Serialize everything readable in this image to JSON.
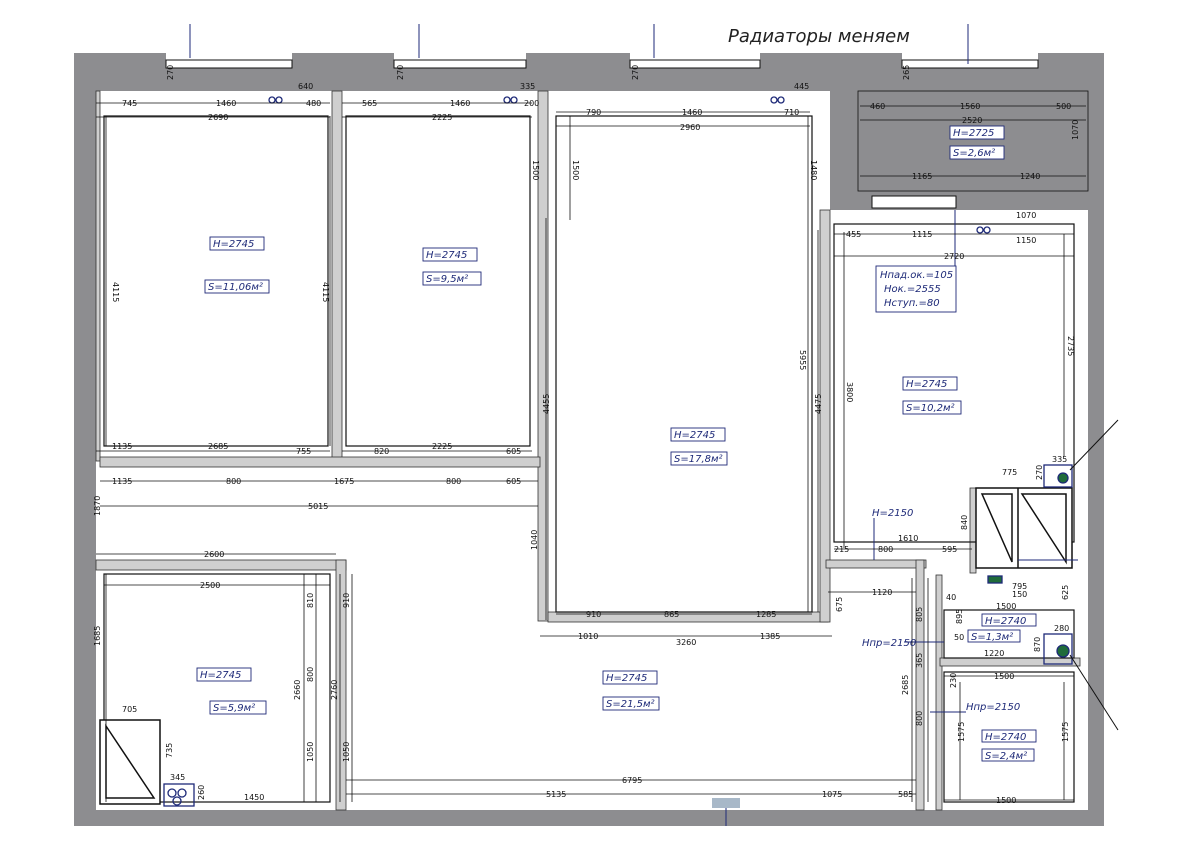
{
  "title": "Радиаторы меняем",
  "colors": {
    "wall": "#8d8d90",
    "partition": "#c8c8c8",
    "line": "#111111",
    "label": "#1e2a78",
    "radiator": "#1e2a78",
    "riser": "#1f6b3a"
  },
  "rooms": [
    {
      "id": "room1",
      "h": "H=2745",
      "s": "S=11,06м²"
    },
    {
      "id": "room2",
      "h": "H=2745",
      "s": "S=9,5м²"
    },
    {
      "id": "room3",
      "h": "H=2745",
      "s": "S=17,8м²"
    },
    {
      "id": "kitchen",
      "h": "H=2745",
      "s": "S=10,2м²"
    },
    {
      "id": "loggia",
      "h": "H=2725",
      "s": "S=2,6м²"
    },
    {
      "id": "room5",
      "h": "H=2745",
      "s": "S=5,9м²"
    },
    {
      "id": "hall",
      "h": "H=2745",
      "s": "S=21,5м²"
    },
    {
      "id": "wc",
      "h": "H=2740",
      "s": "S=1,3м²"
    },
    {
      "id": "bath",
      "h": "H=2740",
      "s": "S=2,4м²"
    }
  ],
  "notes": {
    "window": [
      "Hпад.ок.=105",
      "Hок.=2555",
      "Hступ.=80"
    ],
    "door_1": "H=2150",
    "door_2": "Hпр=2150",
    "door_3": "Hпр=2150"
  },
  "dims": {
    "r1_a": "745",
    "r1_b": "1460",
    "r1_c": "480",
    "r1_w": "2690",
    "r1_h": "4115",
    "r1_bot1": "1135",
    "r1_bot2": "2685",
    "r1_bot3": "755",
    "r2_a": "565",
    "r2_b": "1460",
    "r2_c": "200",
    "r2_w": "2225",
    "r2_h": "4115",
    "r2_side": "1500",
    "r2_bot1": "820",
    "r2_bot2": "2225",
    "r2_bot3": "605",
    "r3_a": "790",
    "r3_b": "1460",
    "r3_c": "710",
    "r3_w": "2960",
    "r3_side": "1500",
    "r3_side2": "1480",
    "r3_h": "5955",
    "r3_h2": "4455",
    "r3_h3": "4475",
    "r3_b1": "910",
    "r3_b2": "865",
    "r3_b3": "1285",
    "r3_c1": "1010",
    "r3_c2": "3260",
    "r3_c3": "1385",
    "w_270": "270",
    "w_640": "640",
    "w_335": "335",
    "w_445": "445",
    "w_265": "265",
    "lg_a": "460",
    "lg_b": "1560",
    "lg_c": "500",
    "lg_w": "2520",
    "lg_h": "1070",
    "lg_d": "1165",
    "lg_e": "1240",
    "k_a": "455",
    "k_b": "1115",
    "k_c": "1150",
    "k_w": "2720",
    "k_top": "1070",
    "k_h": "2735",
    "k_h2": "3800",
    "k_335": "335",
    "k_775": "775",
    "k_b1": "1610",
    "k_b2": "215",
    "k_b3": "800",
    "k_b4": "595",
    "h_1135": "1135",
    "h_800a": "800",
    "h_1675": "1675",
    "h_800b": "800",
    "h_605": "605",
    "h_5015": "5015",
    "h_1870": "1870",
    "h_1040": "1040",
    "r5_w": "2600",
    "r5_w2": "2500",
    "r5_h": "1685",
    "r5_810": "810",
    "r5_910": "910",
    "r5_800": "800",
    "r5_2660": "2660",
    "r5_2760": "2760",
    "r5_1050": "1050",
    "r5_1050b": "1050",
    "r5_705": "705",
    "r5_735": "735",
    "r5_345": "345",
    "r5_260": "260",
    "r5_1450": "1450",
    "bot_5135": "5135",
    "bot_6795": "6795",
    "bot_1075": "1075",
    "bot_585": "585",
    "c_1120": "1120",
    "c_675": "675",
    "wc_805": "805",
    "wc_365": "365",
    "wc_2685": "2685",
    "wc_800": "800",
    "wc_1500": "1500",
    "wc_895": "895",
    "wc_50": "50",
    "wc_280": "280",
    "wc_1220": "1220",
    "wc_795": "795",
    "wc_150": "150",
    "wc_40": "40",
    "wc_625": "625",
    "wc_870": "870",
    "wc_270": "270",
    "wc_840": "840",
    "wc_1500b": "1500",
    "b_1575": "1575",
    "b_1575b": "1575",
    "b_1500": "1500",
    "b_1500b": "1500",
    "b_230": "230"
  }
}
